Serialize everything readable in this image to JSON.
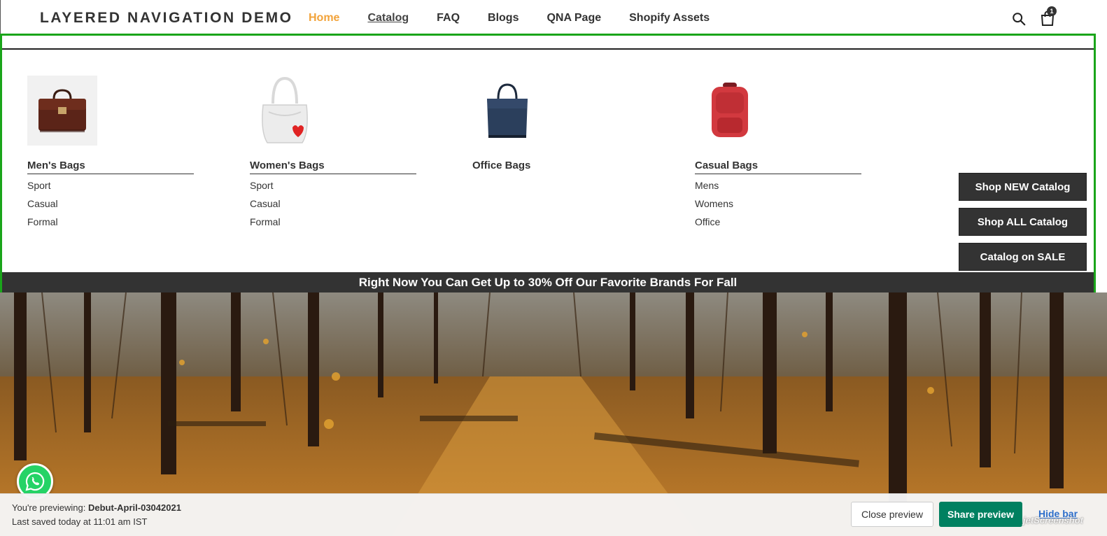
{
  "header": {
    "logo": "LAYERED NAVIGATION DEMO",
    "nav": [
      "Home",
      "Catalog",
      "FAQ",
      "Blogs",
      "QNA Page",
      "Shopify Assets"
    ],
    "cart_count": "1"
  },
  "mega_menu": {
    "columns": [
      {
        "title": "Men's Bags",
        "links": [
          "Sport",
          "Casual",
          "Formal"
        ],
        "image": "brown-briefcase"
      },
      {
        "title": "Women's Bags",
        "links": [
          "Sport",
          "Casual",
          "Formal"
        ],
        "image": "white-handbag"
      },
      {
        "title": "Office Bags",
        "links": [],
        "image": "navy-office-bag"
      },
      {
        "title": "Casual Bags",
        "links": [
          "Mens",
          "Womens",
          "Office"
        ],
        "image": "red-backpack"
      }
    ],
    "buttons": [
      "Shop NEW Catalog",
      "Shop ALL Catalog",
      "Catalog on SALE"
    ],
    "promo": "Right Now You Can Get Up to 30% Off Our Favorite Brands For Fall"
  },
  "preview_bar": {
    "previewing_label": "You're previewing:",
    "theme_name": "Debut-April-03042021",
    "last_saved": "Last saved today at 11:01 am IST",
    "close_label": "Close preview",
    "share_label": "Share preview",
    "hide_label": "Hide bar",
    "watermark": "jetScreenshot"
  },
  "colors": {
    "active_nav": "#f2a33a",
    "highlight_border": "#1aa51a",
    "dark_button": "#333333",
    "share_button": "#008060",
    "whatsapp": "#25d366"
  }
}
